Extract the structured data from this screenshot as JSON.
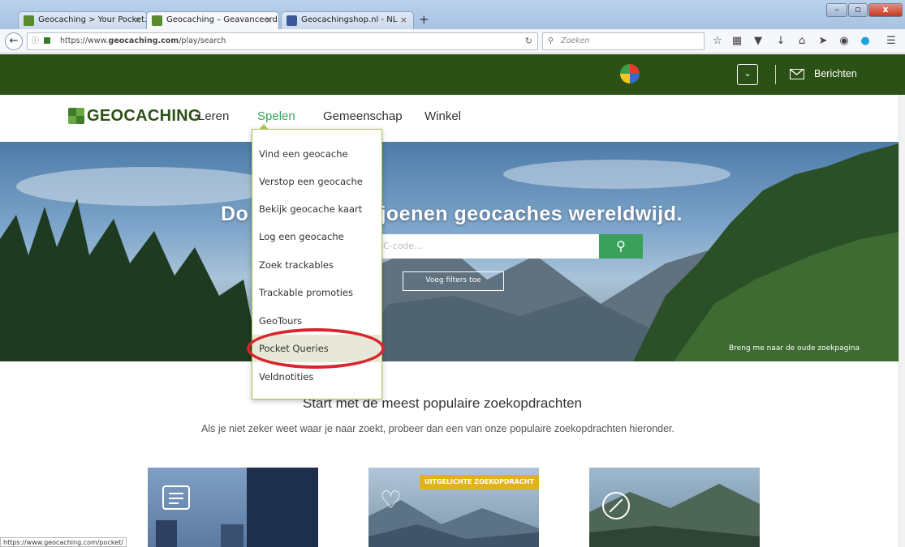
{
  "browser": {
    "tabs": [
      {
        "label": "Geocaching > Your Pocket...",
        "close": "×"
      },
      {
        "label": "Geocaching – Geavanceerd...",
        "close": "×"
      },
      {
        "label": "Geocachingshop.nl - NL",
        "close": "×"
      }
    ],
    "new_tab": "+",
    "window_buttons": [
      "–",
      "▫",
      "x"
    ],
    "url_prefix": "https://www.",
    "url_domain": "geocaching.com",
    "url_path": "/play/search",
    "search_placeholder": "Zoeken",
    "status_url": "https://www.geocaching.com/pocket/"
  },
  "header": {
    "messages_label": "Berichten",
    "logo_text": "GEOCACHING",
    "nav": [
      "Leren",
      "Spelen",
      "Gemeenschap",
      "Winkel"
    ]
  },
  "dropdown": {
    "items": [
      "Vind een geocache",
      "Verstop een geocache",
      "Bekijk geocache kaart",
      "Log een geocache",
      "Zoek trackables",
      "Trackable promoties",
      "GeoTours",
      "Pocket Queries",
      "Veldnotities"
    ],
    "highlighted": "Pocket Queries"
  },
  "hero": {
    "title_part1": "Do",
    "title_part2": "ljoenen geocaches wereldwijd.",
    "input_placeholder": "C-code...",
    "filter_button": "Voeg filters toe",
    "old_search_link": "Breng me naar de oude zoekpagina"
  },
  "popular": {
    "heading_part1": "Start met d",
    "heading_part2": "e meest populaire zoekopdrachten",
    "subtitle": "Als je niet zeker weet waar je naar zoekt, probeer dan een van onze populaire zoekopdrachten hieronder.",
    "featured_badge": "UITGELICHTE ZOEKOPDRACHT"
  },
  "colors": {
    "brand_green": "#2c5116",
    "accent_green": "#3aa05a",
    "dropdown_border": "#a9c34f",
    "highlight_circle": "#d9262c",
    "badge_yellow": "#e0b31c"
  }
}
